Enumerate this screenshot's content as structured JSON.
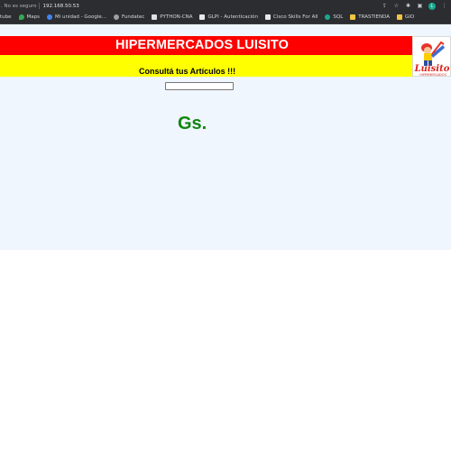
{
  "browser": {
    "security_label": ". No es seguro",
    "url": "192.168.50.53",
    "profile_initial": "L"
  },
  "bookmarks": [
    {
      "label": "tube",
      "icon": "youtube-icon",
      "color": "#ff3b30"
    },
    {
      "label": "Maps",
      "icon": "maps-icon",
      "color": "#34a853"
    },
    {
      "label": "Mi unidad - Google...",
      "icon": "drive-icon",
      "color": "#4285f4"
    },
    {
      "label": "Fundatec",
      "icon": "globe-icon",
      "color": "#9aa0a6"
    },
    {
      "label": "PYTHON-CNA",
      "icon": "page-icon",
      "color": "#e0e0e0"
    },
    {
      "label": "GLPI - Autenticación",
      "icon": "glpi-icon",
      "color": "#e8e8e8"
    },
    {
      "label": "Cisco Skills For All",
      "icon": "cisco-icon",
      "color": "#e8e8e8"
    },
    {
      "label": "SQL",
      "icon": "sql-icon",
      "color": "#1aa890"
    },
    {
      "label": "TRASTIENDA",
      "icon": "folder-icon",
      "color": "#f4c542"
    },
    {
      "label": "GIO",
      "icon": "folder-icon",
      "color": "#f4c542"
    }
  ],
  "page": {
    "title": "HIPERMERCADOS LUISITO",
    "subtitle": "Consultá tus Artículos !!!",
    "search_value": "",
    "currency": "Gs.",
    "logo_text": "Luisito",
    "logo_subtext": "HIPERMERCADOS"
  },
  "colors": {
    "red_band": "#ff0000",
    "yellow_band": "#ffff00",
    "currency_green": "#118611",
    "page_bg": "#f0f6fd"
  }
}
